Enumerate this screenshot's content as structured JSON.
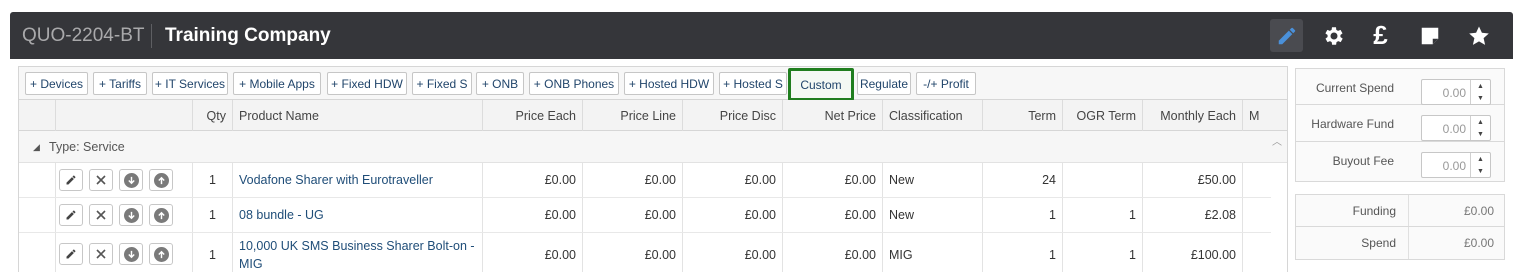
{
  "header": {
    "quote_code": "QUO-2204-BT",
    "company": "Training Company",
    "icons": [
      "pencil-icon",
      "gear-icon",
      "pound-icon",
      "note-icon",
      "star-icon"
    ],
    "pound_symbol": "£",
    "background_color": "#35363a"
  },
  "toolbar": {
    "buttons": [
      "+ Devices",
      "+ Tariffs",
      "+ IT Services",
      "+ Mobile Apps",
      "+ Fixed HDW",
      "+ Fixed S",
      "+ ONB",
      "+ ONB Phones",
      "+ Hosted HDW",
      "+ Hosted S",
      "Custom",
      "Regulate",
      "-/+ Profit"
    ],
    "highlight_color": "#207e1f"
  },
  "grid": {
    "columns": [
      "Qty",
      "Product Name",
      "Price Each",
      "Price Line",
      "Price Disc",
      "Net Price",
      "Classification",
      "Term",
      "OGR Term",
      "Monthly Each",
      "M"
    ],
    "group_label": "Type: Service",
    "rows": [
      {
        "qty": "1",
        "product": "Vodafone Sharer with Eurotraveller",
        "price_each": "£0.00",
        "price_line": "£0.00",
        "price_disc": "£0.00",
        "net_price": "£0.00",
        "classification": "New",
        "term": "24",
        "ogr_term": "",
        "monthly_each": "£50.00"
      },
      {
        "qty": "1",
        "product": "08 bundle - UG",
        "price_each": "£0.00",
        "price_line": "£0.00",
        "price_disc": "£0.00",
        "net_price": "£0.00",
        "classification": "New",
        "term": "1",
        "ogr_term": "1",
        "monthly_each": "£2.08"
      },
      {
        "qty": "1",
        "product": "10,000 UK SMS Business Sharer Bolt-on - MIG",
        "price_each": "£0.00",
        "price_line": "£0.00",
        "price_disc": "£0.00",
        "net_price": "£0.00",
        "classification": "MIG",
        "term": "1",
        "ogr_term": "1",
        "monthly_each": "£100.00"
      }
    ],
    "row_actions": [
      "edit-icon",
      "delete-icon",
      "move-down-icon",
      "move-up-icon"
    ]
  },
  "side_panel": {
    "inputs": [
      {
        "label": "Current Spend",
        "value": "0.00"
      },
      {
        "label": "Hardware Fund",
        "value": "0.00"
      },
      {
        "label": "Buyout Fee",
        "value": "0.00"
      }
    ],
    "summary": [
      {
        "label": "Funding",
        "value": "£0.00"
      },
      {
        "label": "Spend",
        "value": "£0.00"
      }
    ]
  }
}
